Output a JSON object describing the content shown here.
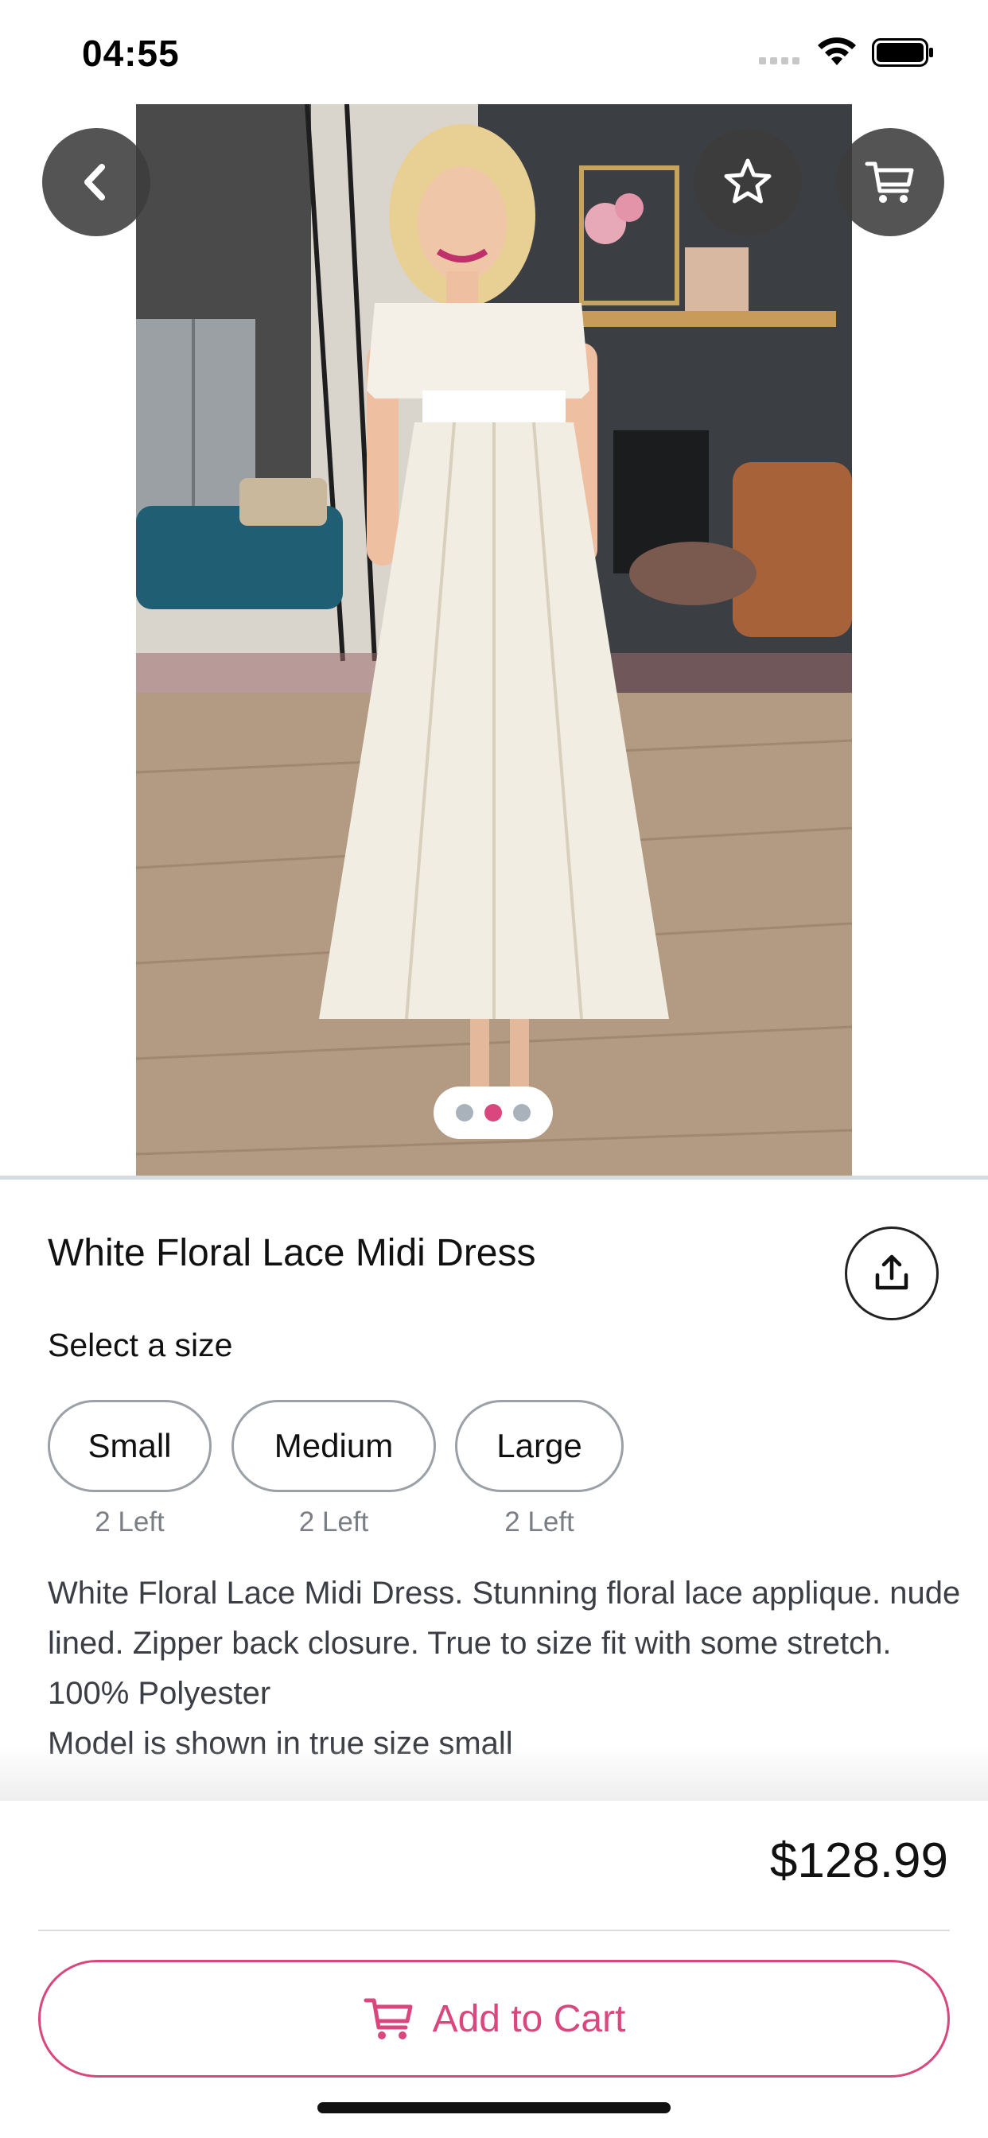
{
  "status_bar": {
    "time": "04:55",
    "icons": [
      "signal-icon",
      "wifi-icon",
      "battery-icon"
    ]
  },
  "hero": {
    "page_count": 3,
    "active_page": 2
  },
  "header_actions": {
    "back_icon": "chevron-left-icon",
    "favorite_icon": "star-icon",
    "cart_icon": "cart-icon"
  },
  "product": {
    "title": "White Floral Lace Midi Dress",
    "share_icon": "share-icon",
    "size_label": "Select a size",
    "sizes": [
      {
        "label": "Small",
        "stock": "2 Left"
      },
      {
        "label": "Medium",
        "stock": "2 Left"
      },
      {
        "label": "Large",
        "stock": "2 Left"
      }
    ],
    "description": "White Floral Lace Midi Dress. Stunning floral lace applique. nude lined. Zipper back closure. True to size fit with some stretch. 100% Polyester\nModel is shown in true size small"
  },
  "purchase": {
    "price": "$128.99",
    "add_to_cart_label": "Add to Cart"
  },
  "colors": {
    "accent": "#d9477e",
    "overlay_button": "#3c3c3c",
    "pager_inactive": "#a9b2ba"
  }
}
